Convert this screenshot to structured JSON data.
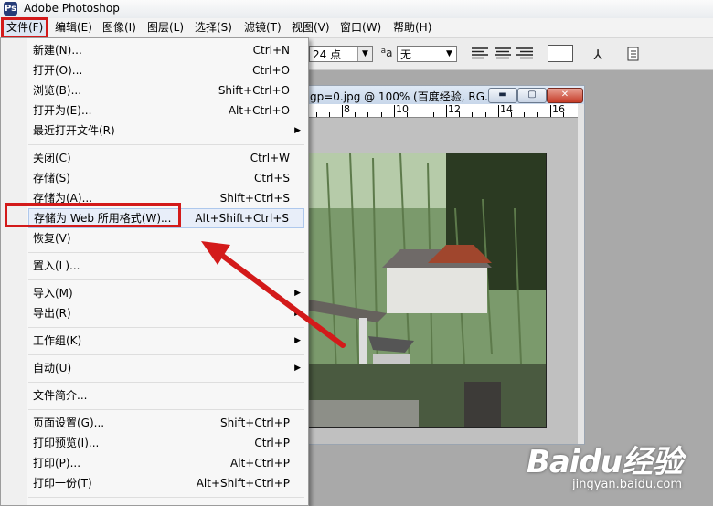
{
  "app": {
    "title": "Adobe Photoshop",
    "icon": "photoshop-app-icon"
  },
  "menubar": [
    {
      "label": "文件(F)"
    },
    {
      "label": "编辑(E)"
    },
    {
      "label": "图像(I)"
    },
    {
      "label": "图层(L)"
    },
    {
      "label": "选择(S)"
    },
    {
      "label": "滤镜(T)"
    },
    {
      "label": "视图(V)"
    },
    {
      "label": "窗口(W)"
    },
    {
      "label": "帮助(H)"
    }
  ],
  "toolbar": {
    "font_size": "24 点",
    "aa_label": "a",
    "antialias": "无"
  },
  "document": {
    "title": "gp=0.jpg @ 100% (百度经验, RG...",
    "ruler_labels": [
      "8",
      "10",
      "12",
      "14",
      "16"
    ]
  },
  "file_menu": [
    {
      "label": "新建(N)...",
      "shortcut": "Ctrl+N"
    },
    {
      "label": "打开(O)...",
      "shortcut": "Ctrl+O"
    },
    {
      "label": "浏览(B)...",
      "shortcut": "Shift+Ctrl+O"
    },
    {
      "label": "打开为(E)...",
      "shortcut": "Alt+Ctrl+O"
    },
    {
      "label": "最近打开文件(R)",
      "shortcut": "",
      "submenu": true
    },
    {
      "label": "关闭(C)",
      "shortcut": "Ctrl+W"
    },
    {
      "label": "存储(S)",
      "shortcut": "Ctrl+S"
    },
    {
      "label": "存储为(A)...",
      "shortcut": "Shift+Ctrl+S"
    },
    {
      "label": "存储为 Web 所用格式(W)...",
      "shortcut": "Alt+Shift+Ctrl+S"
    },
    {
      "label": "恢复(V)",
      "shortcut": ""
    },
    {
      "label": "置入(L)...",
      "shortcut": ""
    },
    {
      "label": "导入(M)",
      "shortcut": "",
      "submenu": true
    },
    {
      "label": "导出(R)",
      "shortcut": "",
      "submenu": true
    },
    {
      "label": "工作组(K)",
      "shortcut": "",
      "submenu": true
    },
    {
      "label": "自动(U)",
      "shortcut": "",
      "submenu": true
    },
    {
      "label": "文件简介...",
      "shortcut": ""
    },
    {
      "label": "页面设置(G)...",
      "shortcut": "Shift+Ctrl+P"
    },
    {
      "label": "打印预览(I)...",
      "shortcut": "Ctrl+P"
    },
    {
      "label": "打印(P)...",
      "shortcut": "Alt+Ctrl+P"
    },
    {
      "label": "打印一份(T)",
      "shortcut": "Alt+Shift+Ctrl+P"
    }
  ],
  "watermark": {
    "logo": "Baidu经验",
    "url": "jingyan.baidu.com"
  },
  "colors": {
    "highlight": "#d31a1a",
    "menu_hover": "#e8eef9"
  }
}
